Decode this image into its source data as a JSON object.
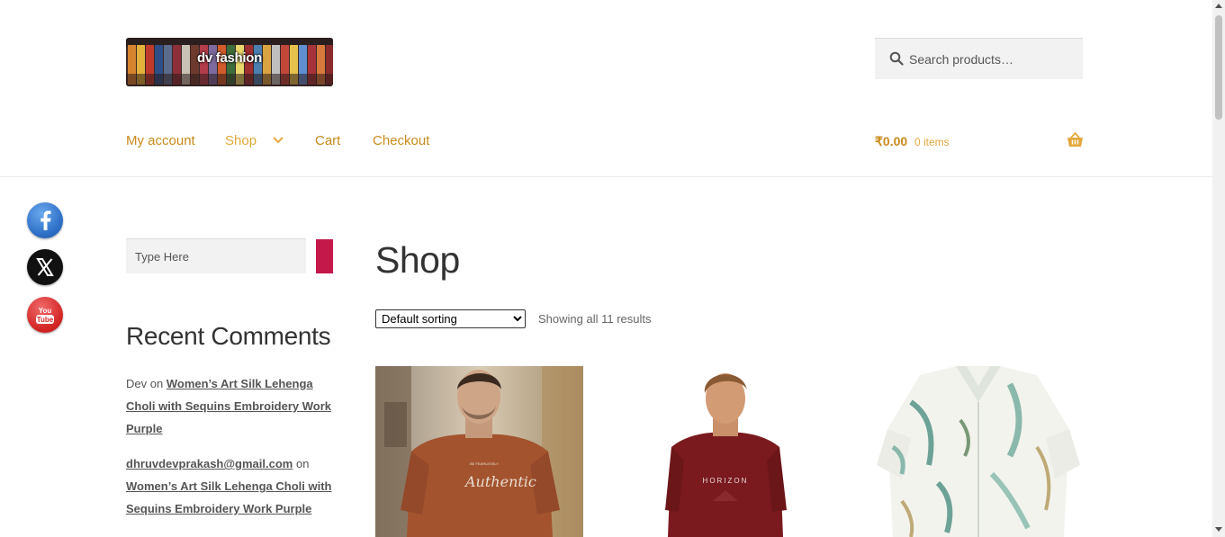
{
  "header": {
    "logo_text": "dv fashion",
    "search_placeholder": "Search products…"
  },
  "nav": {
    "items": [
      {
        "label": "My account"
      },
      {
        "label": "Shop"
      },
      {
        "label": "Cart"
      },
      {
        "label": "Checkout"
      }
    ]
  },
  "cart": {
    "total": "₹0.00",
    "count": "0 items"
  },
  "social": [
    "facebook-icon",
    "x-icon",
    "youtube-icon"
  ],
  "sidebar": {
    "search_placeholder": "Type Here",
    "recent_comments_title": "Recent Comments",
    "comments": [
      {
        "author": "Dev",
        "connector": "on",
        "post": "Women’s Art Silk Lehenga Choli with Sequins Embroidery Work Purple"
      },
      {
        "author": "dhruvdevprakash@gmail.com",
        "connector": "on",
        "post": "Women’s Art Silk Lehenga Choli with Sequins Embroidery Work Purple"
      }
    ]
  },
  "main": {
    "title": "Shop",
    "sort_selected": "Default sorting",
    "result_count": "Showing all 11 results",
    "products": [
      {
        "shirt_text_small": "BE FEARLESSLY",
        "shirt_text": "Authentic"
      },
      {
        "shirt_text": "HORIZON"
      },
      {}
    ]
  },
  "colors": {
    "accent_link": "#c88a1b",
    "accent_active": "#e3a73c",
    "search_button": "#c5184a"
  }
}
